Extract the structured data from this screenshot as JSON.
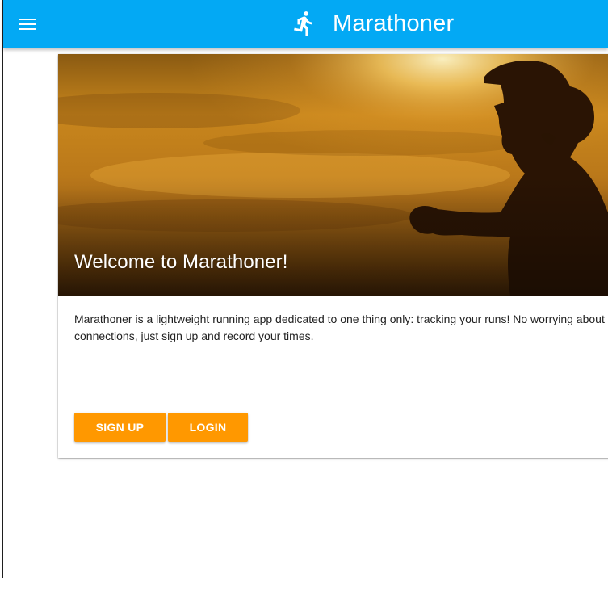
{
  "app_bar": {
    "title": "Marathoner",
    "menu_icon": "hamburger-menu-icon",
    "brand_icon": "running-person-icon",
    "background_color": "#03a9f4"
  },
  "hero": {
    "title": "Welcome to Marathoner!",
    "image": "runner-silhouette-sunset"
  },
  "card": {
    "description_line_1": "Marathoner is a lightweight running app dedicated to one thing only: tracking your runs! No worrying about",
    "description_line_2": "connections, just sign up and record your times."
  },
  "actions": {
    "signup_label": "SIGN UP",
    "login_label": "LOGIN",
    "button_color": "#ff9800"
  }
}
